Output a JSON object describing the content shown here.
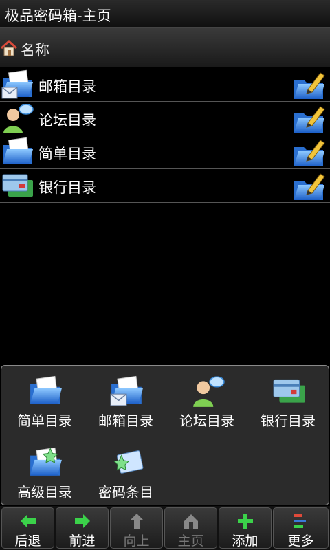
{
  "title": "极品密码箱-主页",
  "header": {
    "label": "名称"
  },
  "list": [
    {
      "label": "邮箱目录",
      "icon": "mail-folder-icon"
    },
    {
      "label": "论坛目录",
      "icon": "forum-user-icon"
    },
    {
      "label": "简单目录",
      "icon": "folder-icon"
    },
    {
      "label": "银行目录",
      "icon": "bank-card-icon"
    }
  ],
  "menu": [
    {
      "label": "简单目录",
      "icon": "folder-icon"
    },
    {
      "label": "邮箱目录",
      "icon": "mail-folder-icon"
    },
    {
      "label": "论坛目录",
      "icon": "forum-user-icon"
    },
    {
      "label": "银行目录",
      "icon": "bank-card-icon"
    },
    {
      "label": "高级目录",
      "icon": "star-folder-icon"
    },
    {
      "label": "密码条目",
      "icon": "star-card-icon"
    }
  ],
  "toolbar": [
    {
      "label": "后退",
      "icon": "arrow-left-icon",
      "enabled": true
    },
    {
      "label": "前进",
      "icon": "arrow-right-icon",
      "enabled": true
    },
    {
      "label": "向上",
      "icon": "arrow-up-icon",
      "enabled": false
    },
    {
      "label": "主页",
      "icon": "home-icon",
      "enabled": false
    },
    {
      "label": "添加",
      "icon": "plus-icon",
      "enabled": true
    },
    {
      "label": "更多",
      "icon": "more-icon",
      "enabled": true
    }
  ]
}
